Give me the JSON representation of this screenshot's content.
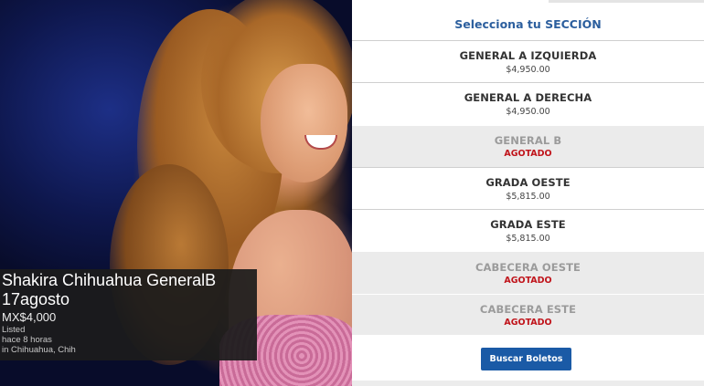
{
  "listing": {
    "title_line1": "Shakira Chihuahua GeneralB",
    "title_line2": "17agosto",
    "price": "MX$4,000",
    "status": "Listed",
    "time": "hace 8 horas",
    "location": "in Chihuahua, Chih"
  },
  "selector": {
    "title": "Selecciona tu SECCIÓN",
    "sections": [
      {
        "name": "GENERAL A IZQUIERDA",
        "price": "$4,950.00",
        "sold_out": false
      },
      {
        "name": "GENERAL A DERECHA",
        "price": "$4,950.00",
        "sold_out": false
      },
      {
        "name": "GENERAL B",
        "status": "AGOTADO",
        "sold_out": true
      },
      {
        "name": "GRADA OESTE",
        "price": "$5,815.00",
        "sold_out": false
      },
      {
        "name": "GRADA ESTE",
        "price": "$5,815.00",
        "sold_out": false
      },
      {
        "name": "CABECERA OESTE",
        "status": "AGOTADO",
        "sold_out": true
      },
      {
        "name": "CABECERA ESTE",
        "status": "AGOTADO",
        "sold_out": true
      }
    ],
    "search_button": "Buscar Boletos"
  },
  "colors": {
    "accent_blue": "#1a5aa6",
    "title_blue": "#2c5f9e",
    "sold_out_red": "#c0141b"
  }
}
